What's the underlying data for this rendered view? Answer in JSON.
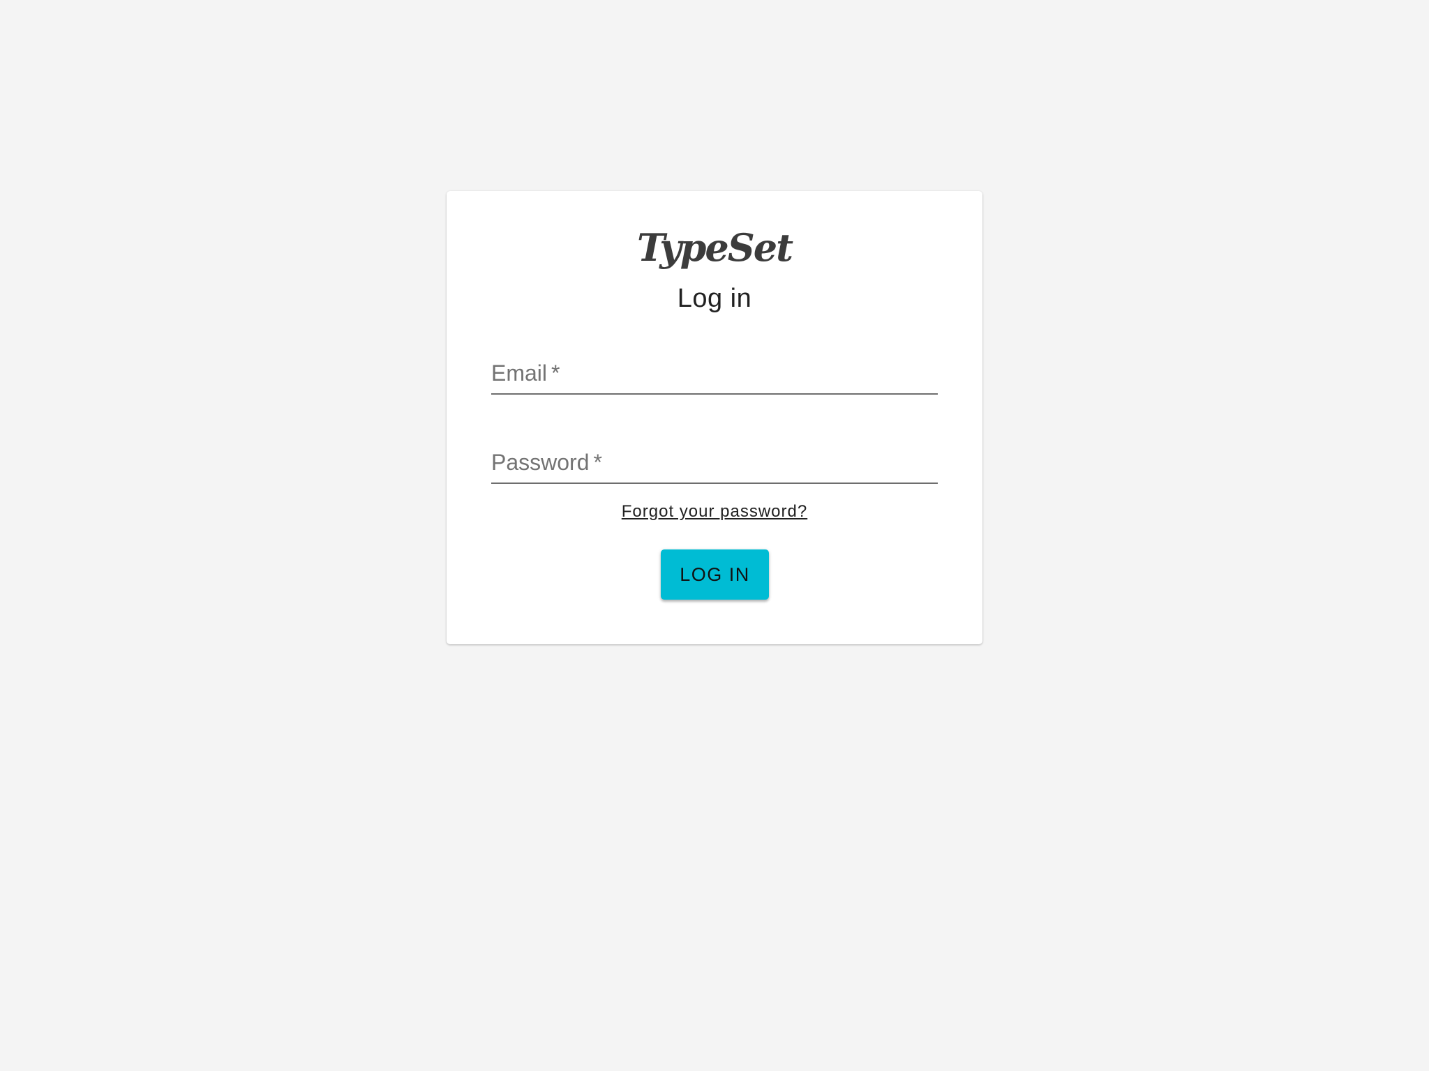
{
  "brand": {
    "logo_text": "TypeSet"
  },
  "login_form": {
    "title": "Log in",
    "email": {
      "label": "Email",
      "required_mark": "*",
      "value": ""
    },
    "password": {
      "label": "Password",
      "required_mark": "*",
      "value": ""
    },
    "forgot_password_link": "Forgot your password?",
    "submit_label": "LOG IN"
  },
  "colors": {
    "page_background": "#f4f4f4",
    "card_background": "#ffffff",
    "accent_button": "#00bcd4",
    "logo_text": "#3c3c3c"
  }
}
